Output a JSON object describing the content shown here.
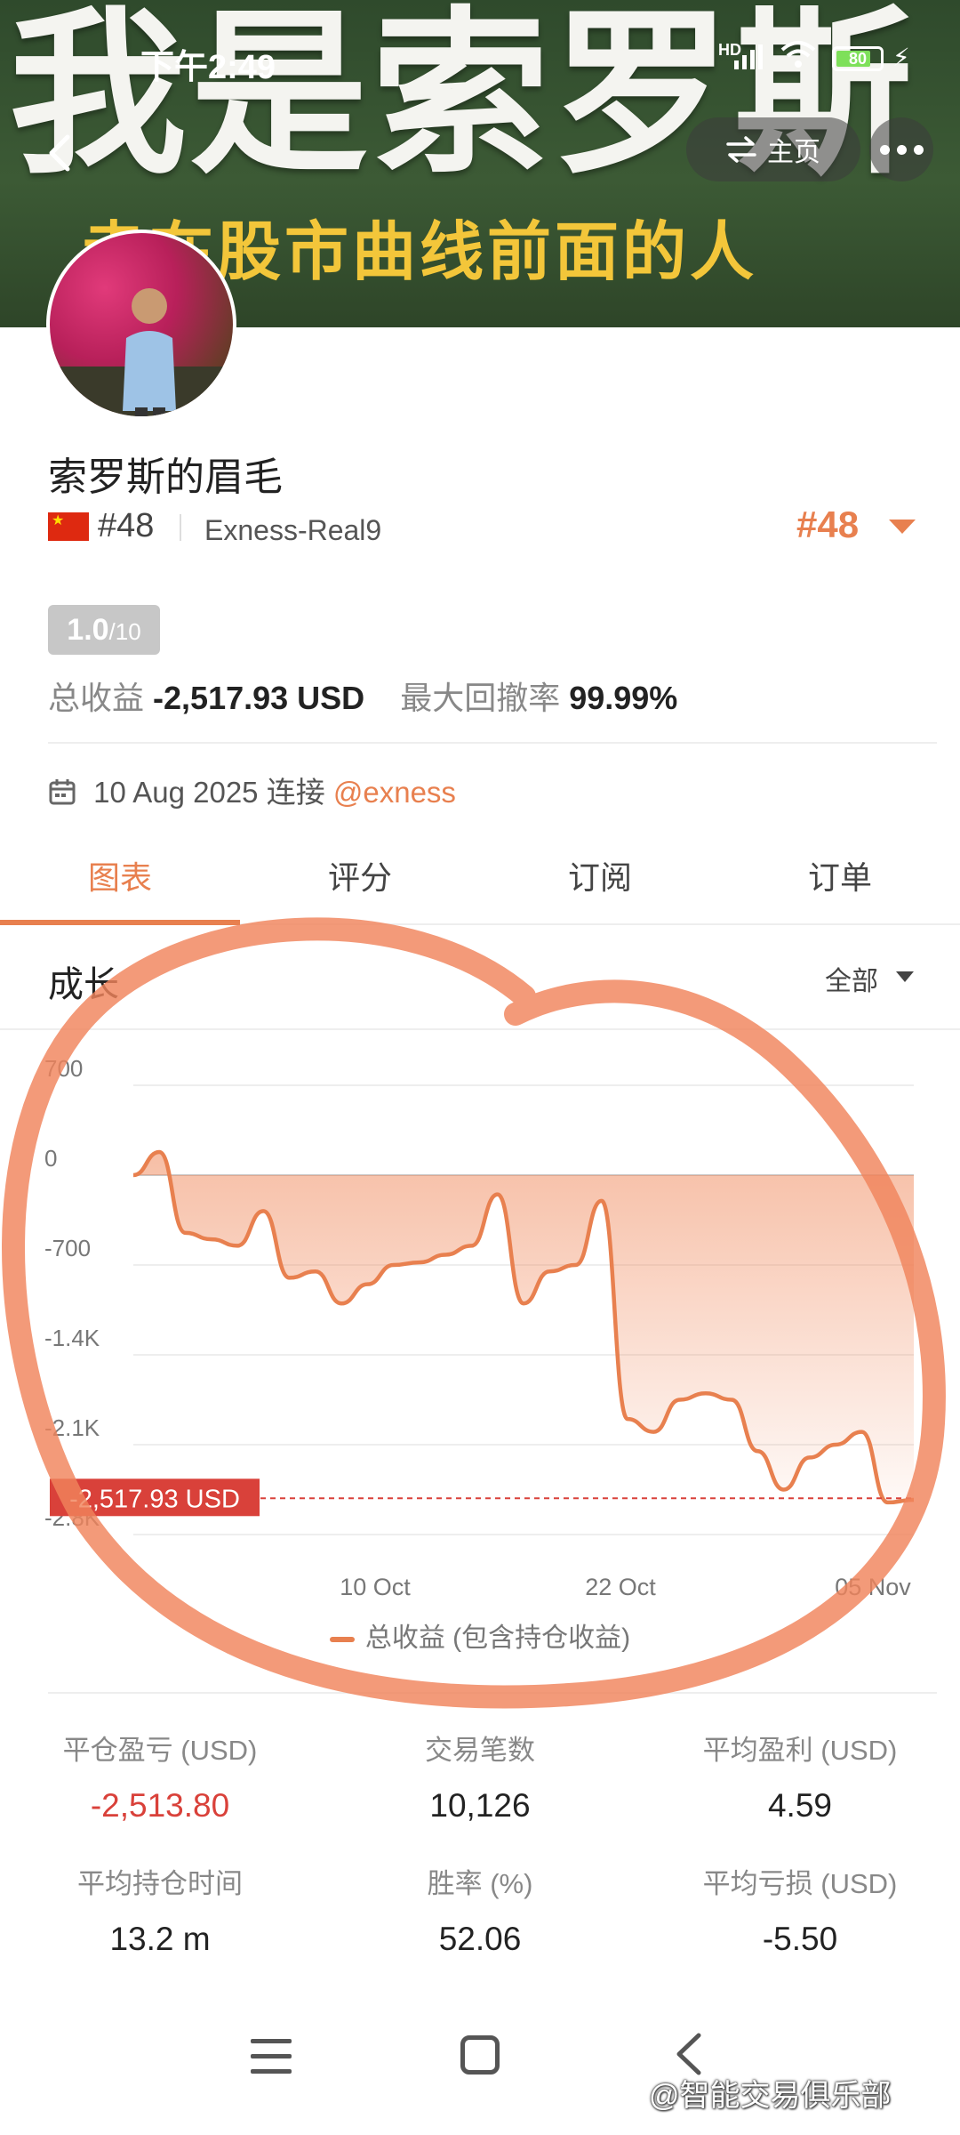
{
  "banner": {
    "title": "我是索罗斯",
    "subtitle": "走在股市曲线前面的人"
  },
  "status_bar": {
    "time": "下午2:49",
    "network": "HD",
    "battery": "80",
    "battery_level": 0.8
  },
  "top_actions": {
    "home_label": "主页"
  },
  "profile": {
    "name": "索罗斯的眉毛",
    "rank": "#48",
    "server": "Exness-Real9",
    "rank_right": "#48",
    "score": "1.0",
    "score_max": "/10",
    "total_profit_label": "总收益",
    "total_profit_value": "-2,517.93 USD",
    "drawdown_label": "最大回撤率",
    "drawdown_value": "99.99%",
    "date": "10 Aug 2025",
    "connect_label": "连接",
    "broker": "@exness"
  },
  "tabs": [
    "图表",
    "评分",
    "订阅",
    "订单"
  ],
  "section": {
    "title": "成长",
    "range": "全部"
  },
  "chart_data": {
    "type": "area",
    "y_ticks": [
      "700",
      "0",
      "-700",
      "-1.4K",
      "-2.1K",
      "-2.8K"
    ],
    "x_ticks": [
      "10 Oct",
      "22 Oct",
      "05 Nov"
    ],
    "ylim": [
      -2800,
      700
    ],
    "current_label": "-2,517.93 USD",
    "current_value": -2517.93,
    "legend": "总收益 (包含持仓收益)",
    "series": [
      {
        "values": [
          0,
          180,
          -450,
          -500,
          -550,
          -280,
          -800,
          -750,
          -1000,
          -850,
          -700,
          -680,
          -620,
          -550,
          -150,
          -1000,
          -750,
          -700,
          -200,
          -1900,
          -2000,
          -1750,
          -1700,
          -1750,
          -2150,
          -2450,
          -2200,
          -2100,
          -2000,
          -2550,
          -2530
        ]
      }
    ]
  },
  "stats": [
    {
      "label": "平仓盈亏 (USD)",
      "value": "-2,513.80"
    },
    {
      "label": "交易笔数",
      "value": "10,126"
    },
    {
      "label": "平均盈利 (USD)",
      "value": "4.59"
    },
    {
      "label": "平均持仓时间",
      "value": "13.2 m"
    },
    {
      "label": "胜率 (%)",
      "value": "52.06"
    },
    {
      "label": "平均亏损 (USD)",
      "value": "-5.50"
    }
  ],
  "watermark": "@智能交易俱乐部",
  "colors": {
    "accent": "#e8804f",
    "negative": "#d9413a",
    "current_label_bg": "#d9413a"
  }
}
